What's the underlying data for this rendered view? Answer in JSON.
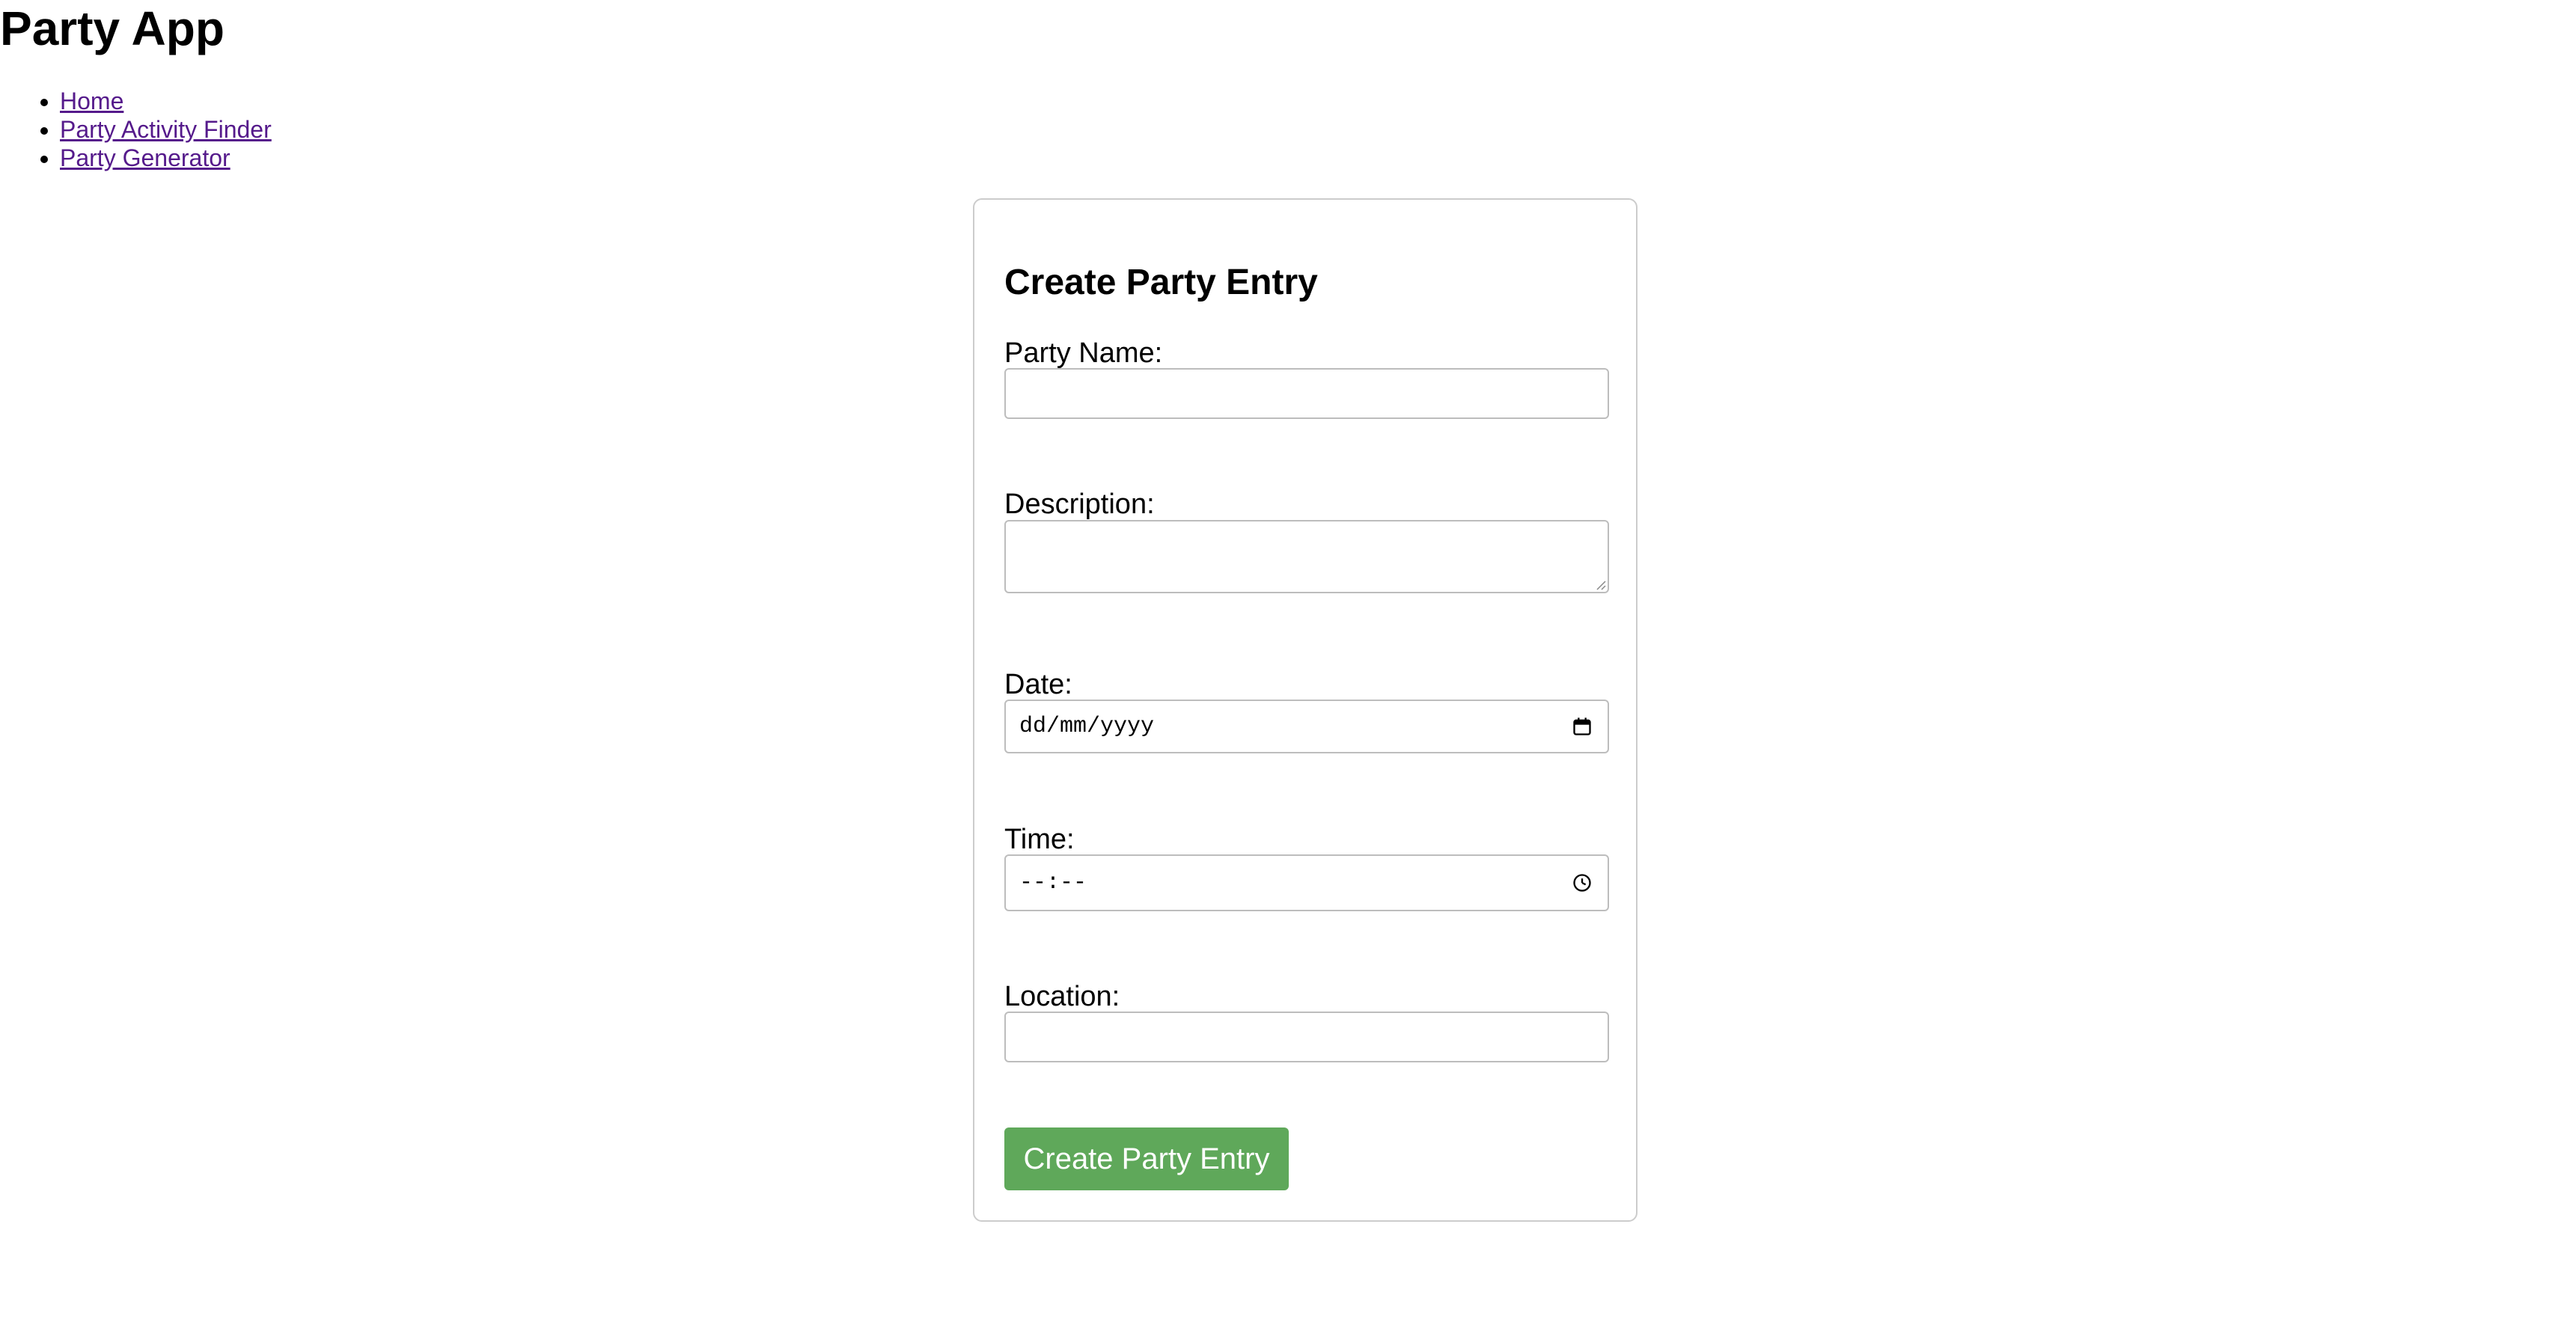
{
  "app": {
    "title": "Party App"
  },
  "nav": {
    "items": [
      {
        "label": "Home"
      },
      {
        "label": "Party Activity Finder"
      },
      {
        "label": "Party Generator"
      }
    ]
  },
  "form": {
    "title": "Create Party Entry",
    "fields": {
      "party_name": {
        "label": "Party Name:",
        "value": "",
        "placeholder": ""
      },
      "description": {
        "label": "Description:",
        "value": "",
        "placeholder": ""
      },
      "date": {
        "label": "Date:",
        "display": "dd/mm/yyyy",
        "icon": "calendar-icon"
      },
      "time": {
        "label": "Time:",
        "display": "--:--",
        "icon": "clock-icon"
      },
      "location": {
        "label": "Location:",
        "value": "",
        "placeholder": ""
      }
    },
    "submit_label": "Create Party Entry"
  },
  "colors": {
    "submit_button": "#5fa85a",
    "visited_link": "#551a8b",
    "card_border": "#cccccc"
  }
}
